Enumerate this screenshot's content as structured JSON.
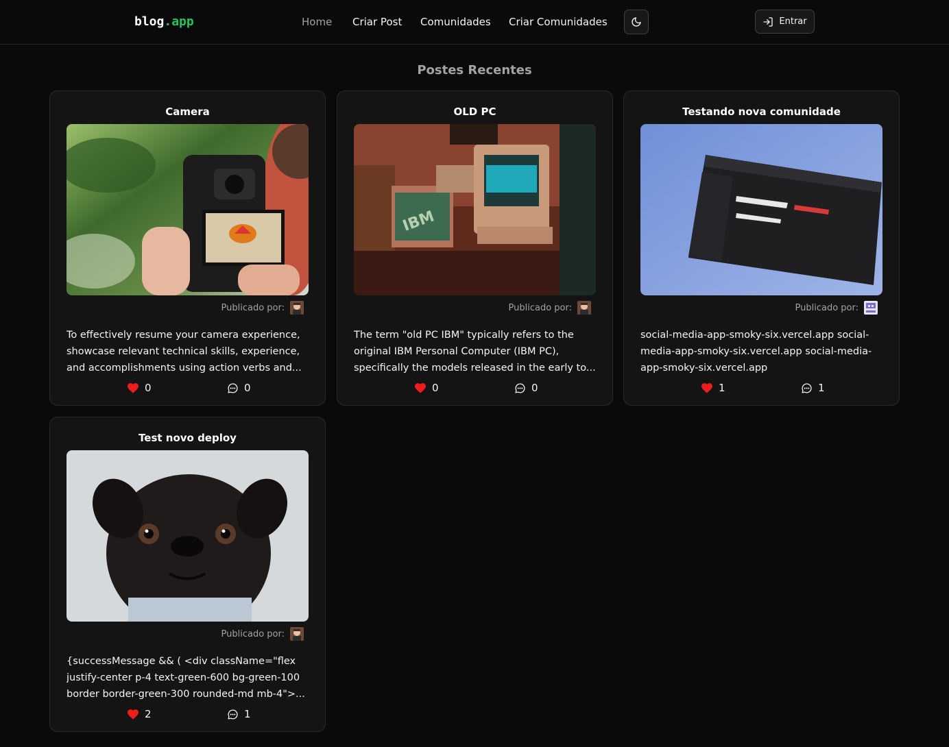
{
  "nav": {
    "logo_main": "blog",
    "logo_accent": ".app",
    "links": [
      "Home",
      "Criar Post",
      "Comunidades",
      "Criar Comunidades"
    ],
    "theme_toggle_icon": "moon-icon",
    "login_icon": "login-icon",
    "login_label": "Entrar"
  },
  "main": {
    "section_title": "Postes Recentes",
    "published_by_label": "Publicado por:",
    "posts": [
      {
        "title": "Camera",
        "image": "camera-photo",
        "excerpt": "To effectively resume your camera experience, showcase relevant technical skills, experience, and accomplishments using action verbs and...",
        "likes": "0",
        "comments": "0"
      },
      {
        "title": "OLD PC",
        "image": "old-pc-photo",
        "excerpt": "The term \"old PC IBM\" typically refers to the original IBM Personal Computer (IBM PC), specifically the models released in the early to...",
        "likes": "0",
        "comments": "0"
      },
      {
        "title": "Testando nova comunidade",
        "image": "screen-photo",
        "excerpt": "social-media-app-smoky-six.vercel.app social-media-app-smoky-six.vercel.app social-media-app-smoky-six.vercel.app",
        "likes": "1",
        "comments": "1"
      },
      {
        "title": "Test novo deploy",
        "image": "pug-photo",
        "excerpt": "{successMessage && ( <div className=\"flex justify-center p-4 text-green-600 bg-green-100 border border-green-300 rounded-md mb-4\">...",
        "likes": "2",
        "comments": "1"
      }
    ]
  },
  "colors": {
    "background": "#0a0a0a",
    "card": "#141414",
    "accent_green": "#22c55e",
    "like_red": "#ef1c1c"
  }
}
